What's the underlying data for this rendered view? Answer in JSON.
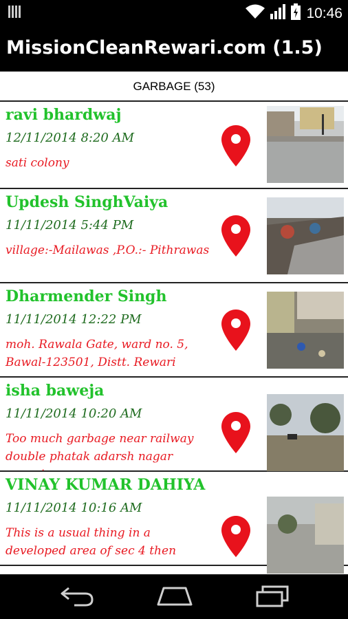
{
  "status_bar": {
    "time": "10:46"
  },
  "app_bar": {
    "title": "MissionCleanRewari.com (1.5)"
  },
  "section": {
    "title": "GARBAGE (53)"
  },
  "items": [
    {
      "name": "ravi bhardwaj",
      "date": "12/11/2014  8:20 AM",
      "address": "sati colony"
    },
    {
      "name": "Updesh SinghVaiya",
      "date": "11/11/2014  5:44 PM",
      "address": "village:-Mailawas ,P.O.:- Pithrawas"
    },
    {
      "name": "Dharmender Singh",
      "date": "11/11/2014 12:22 PM",
      "address": "moh. Rawala Gate, ward no. 5, Bawal-123501, Distt. Rewari"
    },
    {
      "name": "isha baweja",
      "date": "11/11/2014 10:20 AM",
      "address": "Too much garbage near railway double phatak adarsh nagar rewari"
    },
    {
      "name": "VINAY KUMAR DAHIYA",
      "date": "11/11/2014 10:16 AM",
      "address": "This is a usual thing in a developed area of sec 4 then"
    }
  ],
  "colors": {
    "name": "#22c22c",
    "date": "#1e6b1e",
    "address": "#e81a22",
    "pin": "#e8121c"
  },
  "icons": [
    "signal-icon",
    "wifi-icon",
    "cell-signal-icon",
    "battery-icon",
    "map-pin-icon",
    "back-icon",
    "home-icon",
    "recent-apps-icon"
  ]
}
